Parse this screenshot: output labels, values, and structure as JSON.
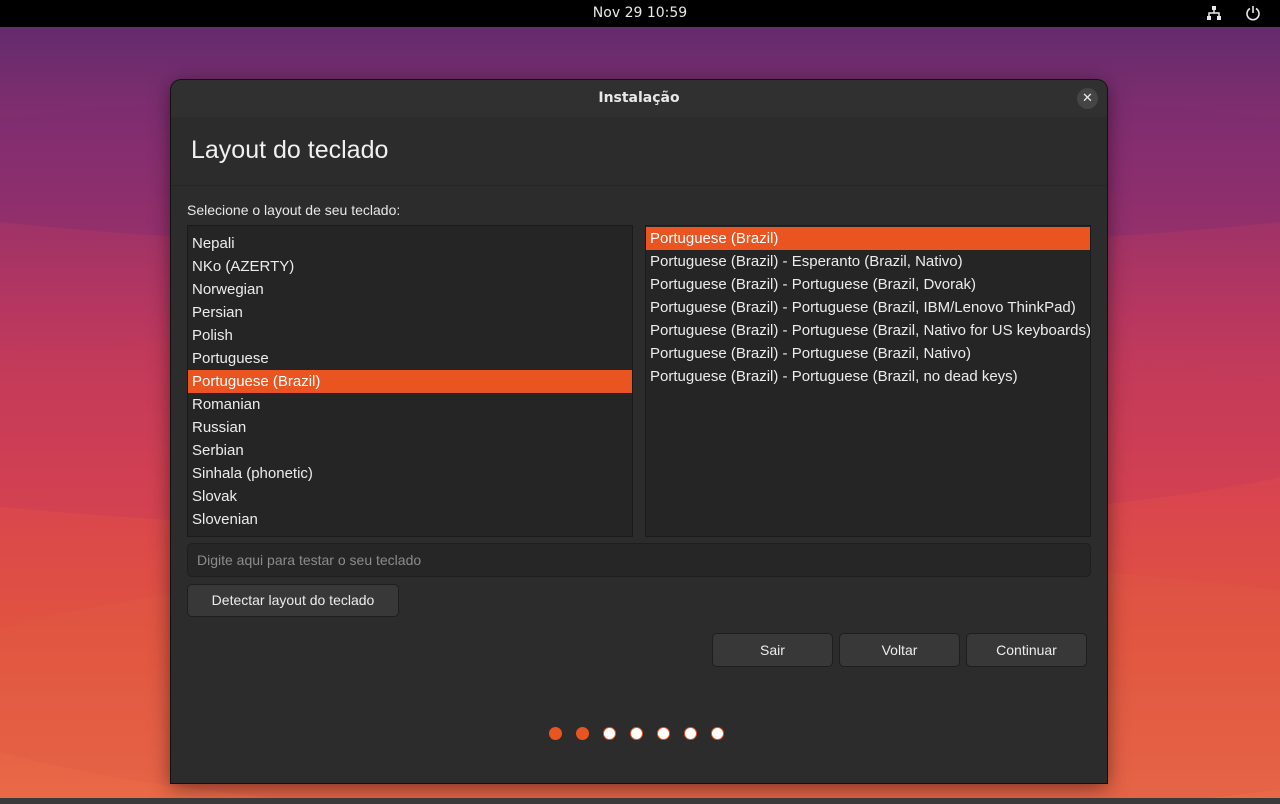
{
  "topbar": {
    "clock": "Nov 29  10:59",
    "icons": [
      "network-icon",
      "power-icon"
    ]
  },
  "window": {
    "title": "Instalação",
    "close_glyph": "✕",
    "page_title": "Layout do teclado",
    "select_label": "Selecione o layout de seu teclado:"
  },
  "layouts": {
    "items": [
      "Nepali",
      "NKo (AZERTY)",
      "Norwegian",
      "Persian",
      "Polish",
      "Portuguese",
      "Portuguese (Brazil)",
      "Romanian",
      "Russian",
      "Serbian",
      "Sinhala (phonetic)",
      "Slovak",
      "Slovenian"
    ],
    "selected": "Portuguese (Brazil)"
  },
  "variants": {
    "items": [
      "Portuguese (Brazil)",
      "Portuguese (Brazil) - Esperanto (Brazil, Nativo)",
      "Portuguese (Brazil) - Portuguese (Brazil, Dvorak)",
      "Portuguese (Brazil) - Portuguese (Brazil, IBM/Lenovo ThinkPad)",
      "Portuguese (Brazil) - Portuguese (Brazil, Nativo for US keyboards)",
      "Portuguese (Brazil) - Portuguese (Brazil, Nativo)",
      "Portuguese (Brazil) - Portuguese (Brazil, no dead keys)"
    ],
    "selected": "Portuguese (Brazil)"
  },
  "test_input": {
    "placeholder": "Digite aqui para testar o seu teclado",
    "value": ""
  },
  "buttons": {
    "detect": "Detectar layout do teclado",
    "quit": "Sair",
    "back": "Voltar",
    "continue": "Continuar"
  },
  "progress": {
    "total_steps": 7,
    "completed_steps": 2
  },
  "colors": {
    "accent": "#e95420",
    "window_bg": "#2c2c2c"
  }
}
